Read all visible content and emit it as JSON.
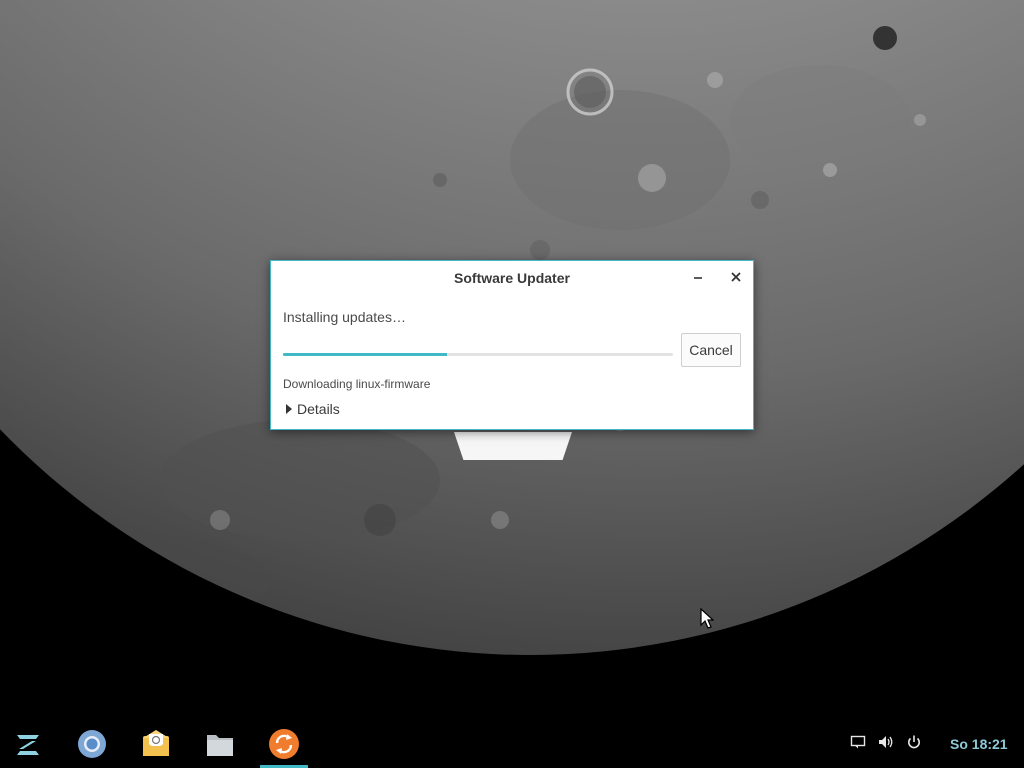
{
  "desktop": {
    "wallpaper": "moon"
  },
  "dialog": {
    "title": "Software Updater",
    "status_heading": "Installing updates…",
    "progress": 0.42,
    "cancel_label": "Cancel",
    "sub_status": "Downloading linux-firmware",
    "details_label": "Details",
    "accent_color": "#41b8c5"
  },
  "taskbar": {
    "apps": [
      {
        "name": "zorin-menu",
        "icon": "zorin-logo-icon"
      },
      {
        "name": "chromium",
        "icon": "chromium-icon"
      },
      {
        "name": "mail",
        "icon": "mail-icon"
      },
      {
        "name": "files",
        "icon": "folder-icon"
      },
      {
        "name": "software-updater",
        "icon": "software-updater-icon",
        "active": true
      }
    ],
    "tray": [
      "notification-icon",
      "volume-icon",
      "power-icon"
    ],
    "clock": "So 18:21",
    "clock_color": "#8ec9d8"
  }
}
